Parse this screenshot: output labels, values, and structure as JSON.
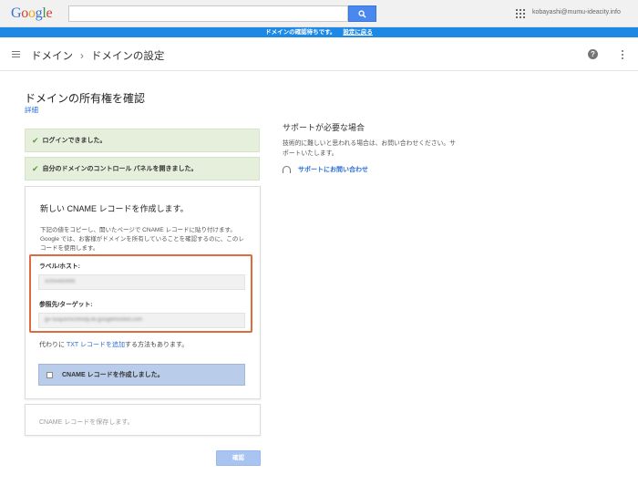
{
  "topbar": {
    "logo": "Google",
    "search": {
      "value": "",
      "placeholder": ""
    },
    "account_email": "kobayashi@mumu-ideacity.info"
  },
  "notice": {
    "message": "ドメインの確認待ちです。",
    "link": "設定に戻る"
  },
  "header": {
    "breadcrumb": [
      "ドメイン",
      "ドメインの設定"
    ],
    "separator": "›"
  },
  "page": {
    "title": "ドメインの所有権を確認",
    "details_link": "詳細"
  },
  "steps_done": [
    {
      "label": "ログインできました。"
    },
    {
      "label": "自分のドメインのコントロール パネルを開きました。"
    }
  ],
  "cname_card": {
    "title": "新しい CNAME レコードを作成します。",
    "description": "下記の値をコピーし、開いたページで CNAME レコードに貼り付けます。Google では、お客様がドメインを所有していることを確認するのに、このレコードを使用します。",
    "label_host": "ラベル/ホスト:",
    "host_value": "srztvvdzrb9z",
    "target_label": "参照先/ターゲット:",
    "target_value": "gv-5uqu5rncnhsdy.dv.googlehosted.com",
    "alt_prefix": "代わりに ",
    "alt_link": "TXT レコードを追加",
    "alt_suffix": "する方法もあります。",
    "checkbox_label": "CNAME レコードを作成しました。",
    "checked": false
  },
  "save_card": {
    "text": "CNAME レコードを保存します。"
  },
  "confirm_button": "確認",
  "support": {
    "title": "サポートが必要な場合",
    "description": "技術的に難しいと思われる場合は、お問い合わせください。サポートいたします。",
    "link": "サポートにお問い合わせ"
  },
  "colors": {
    "accent_blue": "#1e88e5",
    "search_button": "#4a87ee",
    "done_bg": "#e6efdc",
    "highlight_border": "#e06a3f",
    "checkbox_row_bg": "#b9cdea",
    "confirm_disabled": "#a8c4f0"
  },
  "icons": [
    "search-icon",
    "apps-icon",
    "menu-icon",
    "help-icon",
    "more-vert-icon",
    "check-icon",
    "headset-icon"
  ]
}
